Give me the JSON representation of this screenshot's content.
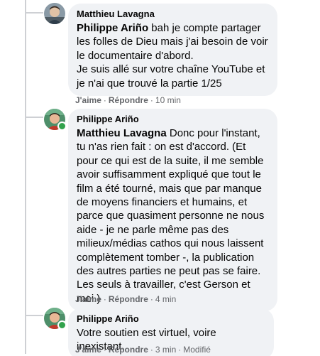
{
  "comments": [
    {
      "author": "Matthieu Lavagna",
      "mention": "Philippe Ariño",
      "text": "bah je compte partager les folles de Dieu mais j'ai besoin de voir le documentaire d'abord.",
      "text2": "Je suis allé sur votre chaîne YouTube et je n'ai que trouvé la partie 1/25",
      "like_label": "J'aime",
      "reply_label": "Répondre",
      "time": "10 min",
      "online": false
    },
    {
      "author": "Philippe Ariño",
      "mention": "Matthieu Lavagna",
      "text": "Donc pour l'instant, tu n'as rien fait : on est d'accord. (Et pour ce qui est de la suite, il me semble avoir suffisamment expliqué que tout le film a été tourné, mais que par manque de moyens financiers et humains, et parce que quasiment personne ne nous aide - je ne parle même pas des milieux/médias cathos qui nous laissent complètement tomber -, la publication des autres parties ne peut pas se faire. Les seuls à travailler, c'est Gerson et moi.)",
      "like_label": "J'aime",
      "reply_label": "Répondre",
      "time": "4 min",
      "online": true
    },
    {
      "author": "Philippe Ariño",
      "text": "Votre soutien est virtuel, voire inexistant.",
      "like_label": "J'aime",
      "reply_label": "Répondre",
      "time": "3 min",
      "edited_label": "Modifié",
      "online": true
    }
  ],
  "colors": {
    "bubble": "#f0f2f5",
    "meta": "#65676b",
    "online": "#31a24c",
    "thread_line": "#ced0d4"
  }
}
